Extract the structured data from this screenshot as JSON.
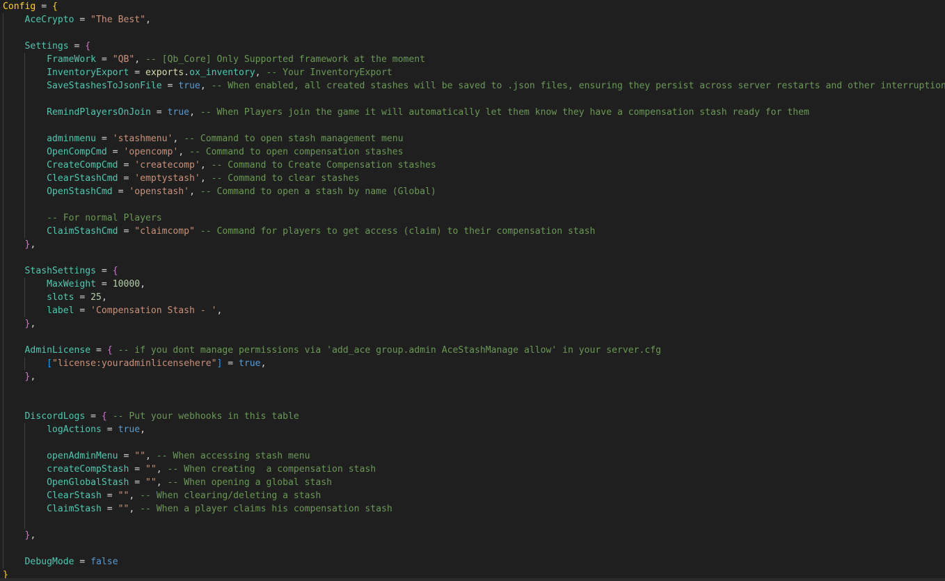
{
  "editor": {
    "lines": [
      [
        {
          "t": "Config",
          "c": "t-cfg"
        },
        {
          "t": " = ",
          "c": "t-op"
        },
        {
          "t": "{",
          "c": "b0"
        }
      ],
      [
        {
          "t": "    "
        },
        {
          "t": "AceCrypto",
          "c": "t-var"
        },
        {
          "t": " = ",
          "c": "t-op"
        },
        {
          "t": "\"The Best\"",
          "c": "t-str"
        },
        {
          "t": ",",
          "c": "t-op"
        }
      ],
      [],
      [
        {
          "t": "    "
        },
        {
          "t": "Settings",
          "c": "t-var"
        },
        {
          "t": " = ",
          "c": "t-op"
        },
        {
          "t": "{",
          "c": "b1"
        }
      ],
      [
        {
          "t": "        "
        },
        {
          "t": "FrameWork",
          "c": "t-var"
        },
        {
          "t": " = ",
          "c": "t-op"
        },
        {
          "t": "\"QB\"",
          "c": "t-str"
        },
        {
          "t": ", ",
          "c": "t-op"
        },
        {
          "t": "-- [Qb_Core] Only Supported framework at the moment",
          "c": "t-com"
        }
      ],
      [
        {
          "t": "        "
        },
        {
          "t": "InventoryExport",
          "c": "t-var"
        },
        {
          "t": " = ",
          "c": "t-op"
        },
        {
          "t": "exports",
          "c": "t-fn"
        },
        {
          "t": ".",
          "c": "t-op"
        },
        {
          "t": "ox_inventory",
          "c": "t-var"
        },
        {
          "t": ", ",
          "c": "t-op"
        },
        {
          "t": "-- Your InventoryExport",
          "c": "t-com"
        }
      ],
      [
        {
          "t": "        "
        },
        {
          "t": "SaveStashesToJsonFile",
          "c": "t-var"
        },
        {
          "t": " = ",
          "c": "t-op"
        },
        {
          "t": "true",
          "c": "t-kw"
        },
        {
          "t": ", ",
          "c": "t-op"
        },
        {
          "t": "-- When enabled, all created stashes will be saved to .json files, ensuring they persist across server restarts and other interruptions.",
          "c": "t-com"
        }
      ],
      [],
      [
        {
          "t": "        "
        },
        {
          "t": "RemindPlayersOnJoin",
          "c": "t-var"
        },
        {
          "t": " = ",
          "c": "t-op"
        },
        {
          "t": "true",
          "c": "t-kw"
        },
        {
          "t": ", ",
          "c": "t-op"
        },
        {
          "t": "-- When Players join the game it will automatically let them know they have a compensation stash ready for them",
          "c": "t-com"
        }
      ],
      [],
      [
        {
          "t": "        "
        },
        {
          "t": "adminmenu",
          "c": "t-var"
        },
        {
          "t": " = ",
          "c": "t-op"
        },
        {
          "t": "'stashmenu'",
          "c": "t-str"
        },
        {
          "t": ", ",
          "c": "t-op"
        },
        {
          "t": "-- Command to open stash management menu",
          "c": "t-com"
        }
      ],
      [
        {
          "t": "        "
        },
        {
          "t": "OpenCompCmd",
          "c": "t-var"
        },
        {
          "t": " = ",
          "c": "t-op"
        },
        {
          "t": "'opencomp'",
          "c": "t-str"
        },
        {
          "t": ", ",
          "c": "t-op"
        },
        {
          "t": "-- Command to open compensation stashes",
          "c": "t-com"
        }
      ],
      [
        {
          "t": "        "
        },
        {
          "t": "CreateCompCmd",
          "c": "t-var"
        },
        {
          "t": " = ",
          "c": "t-op"
        },
        {
          "t": "'createcomp'",
          "c": "t-str"
        },
        {
          "t": ", ",
          "c": "t-op"
        },
        {
          "t": "-- Command to Create Compensation stashes",
          "c": "t-com"
        }
      ],
      [
        {
          "t": "        "
        },
        {
          "t": "ClearStashCmd",
          "c": "t-var"
        },
        {
          "t": " = ",
          "c": "t-op"
        },
        {
          "t": "'emptystash'",
          "c": "t-str"
        },
        {
          "t": ", ",
          "c": "t-op"
        },
        {
          "t": "-- Command to clear stashes",
          "c": "t-com"
        }
      ],
      [
        {
          "t": "        "
        },
        {
          "t": "OpenStashCmd",
          "c": "t-var"
        },
        {
          "t": " = ",
          "c": "t-op"
        },
        {
          "t": "'openstash'",
          "c": "t-str"
        },
        {
          "t": ", ",
          "c": "t-op"
        },
        {
          "t": "-- Command to open a stash by name (Global)",
          "c": "t-com"
        }
      ],
      [],
      [
        {
          "t": "        "
        },
        {
          "t": "-- For normal Players",
          "c": "t-com"
        }
      ],
      [
        {
          "t": "        "
        },
        {
          "t": "ClaimStashCmd",
          "c": "t-var"
        },
        {
          "t": " = ",
          "c": "t-op"
        },
        {
          "t": "\"claimcomp\"",
          "c": "t-str"
        },
        {
          "t": " ",
          "c": "t-op"
        },
        {
          "t": "-- Command for players to get access (claim) to their compensation stash",
          "c": "t-com"
        }
      ],
      [
        {
          "t": "    "
        },
        {
          "t": "}",
          "c": "b1"
        },
        {
          "t": ",",
          "c": "t-op"
        }
      ],
      [],
      [
        {
          "t": "    "
        },
        {
          "t": "StashSettings",
          "c": "t-var"
        },
        {
          "t": " = ",
          "c": "t-op"
        },
        {
          "t": "{",
          "c": "b1"
        }
      ],
      [
        {
          "t": "        "
        },
        {
          "t": "MaxWeight",
          "c": "t-var"
        },
        {
          "t": " = ",
          "c": "t-op"
        },
        {
          "t": "10000",
          "c": "t-num"
        },
        {
          "t": ",",
          "c": "t-op"
        }
      ],
      [
        {
          "t": "        "
        },
        {
          "t": "slots",
          "c": "t-var"
        },
        {
          "t": " = ",
          "c": "t-op"
        },
        {
          "t": "25",
          "c": "t-num"
        },
        {
          "t": ",",
          "c": "t-op"
        }
      ],
      [
        {
          "t": "        "
        },
        {
          "t": "label",
          "c": "t-var"
        },
        {
          "t": " = ",
          "c": "t-op"
        },
        {
          "t": "'Compensation Stash - '",
          "c": "t-str"
        },
        {
          "t": ",",
          "c": "t-op"
        }
      ],
      [
        {
          "t": "    "
        },
        {
          "t": "}",
          "c": "b1"
        },
        {
          "t": ",",
          "c": "t-op"
        }
      ],
      [],
      [
        {
          "t": "    "
        },
        {
          "t": "AdminLicense",
          "c": "t-var"
        },
        {
          "t": " = ",
          "c": "t-op"
        },
        {
          "t": "{",
          "c": "b1"
        },
        {
          "t": " ",
          "c": "t-op"
        },
        {
          "t": "-- if you dont manage permissions via 'add_ace group.admin AceStashManage allow' in your server.cfg",
          "c": "t-com"
        }
      ],
      [
        {
          "t": "        "
        },
        {
          "t": "[",
          "c": "b2"
        },
        {
          "t": "\"license:youradminlicensehere\"",
          "c": "t-str"
        },
        {
          "t": "]",
          "c": "b2"
        },
        {
          "t": " = ",
          "c": "t-op"
        },
        {
          "t": "true",
          "c": "t-kw"
        },
        {
          "t": ",",
          "c": "t-op"
        }
      ],
      [
        {
          "t": "    "
        },
        {
          "t": "}",
          "c": "b1"
        },
        {
          "t": ",",
          "c": "t-op"
        }
      ],
      [],
      [],
      [
        {
          "t": "    "
        },
        {
          "t": "DiscordLogs",
          "c": "t-var"
        },
        {
          "t": " = ",
          "c": "t-op"
        },
        {
          "t": "{",
          "c": "b1"
        },
        {
          "t": " ",
          "c": "t-op"
        },
        {
          "t": "-- Put your webhooks in this table",
          "c": "t-com"
        }
      ],
      [
        {
          "t": "        "
        },
        {
          "t": "logActions",
          "c": "t-var"
        },
        {
          "t": " = ",
          "c": "t-op"
        },
        {
          "t": "true",
          "c": "t-kw"
        },
        {
          "t": ",",
          "c": "t-op"
        }
      ],
      [],
      [
        {
          "t": "        "
        },
        {
          "t": "openAdminMenu",
          "c": "t-var"
        },
        {
          "t": " = ",
          "c": "t-op"
        },
        {
          "t": "\"\"",
          "c": "t-str"
        },
        {
          "t": ", ",
          "c": "t-op"
        },
        {
          "t": "-- When accessing stash menu",
          "c": "t-com"
        }
      ],
      [
        {
          "t": "        "
        },
        {
          "t": "createCompStash",
          "c": "t-var"
        },
        {
          "t": " = ",
          "c": "t-op"
        },
        {
          "t": "\"\"",
          "c": "t-str"
        },
        {
          "t": ", ",
          "c": "t-op"
        },
        {
          "t": "-- When creating  a compensation stash",
          "c": "t-com"
        }
      ],
      [
        {
          "t": "        "
        },
        {
          "t": "OpenGlobalStash",
          "c": "t-var"
        },
        {
          "t": " = ",
          "c": "t-op"
        },
        {
          "t": "\"\"",
          "c": "t-str"
        },
        {
          "t": ", ",
          "c": "t-op"
        },
        {
          "t": "-- When opening a global stash",
          "c": "t-com"
        }
      ],
      [
        {
          "t": "        "
        },
        {
          "t": "ClearStash",
          "c": "t-var"
        },
        {
          "t": " = ",
          "c": "t-op"
        },
        {
          "t": "\"\"",
          "c": "t-str"
        },
        {
          "t": ", ",
          "c": "t-op"
        },
        {
          "t": "-- When clearing/deleting a stash",
          "c": "t-com"
        }
      ],
      [
        {
          "t": "        "
        },
        {
          "t": "ClaimStash",
          "c": "t-var"
        },
        {
          "t": " = ",
          "c": "t-op"
        },
        {
          "t": "\"\"",
          "c": "t-str"
        },
        {
          "t": ", ",
          "c": "t-op"
        },
        {
          "t": "-- When a player claims his compensation stash",
          "c": "t-com"
        }
      ],
      [],
      [
        {
          "t": "    "
        },
        {
          "t": "}",
          "c": "b1"
        },
        {
          "t": ",",
          "c": "t-op"
        }
      ],
      [],
      [
        {
          "t": "    "
        },
        {
          "t": "DebugMode",
          "c": "t-var"
        },
        {
          "t": " = ",
          "c": "t-op"
        },
        {
          "t": "false",
          "c": "t-kw"
        }
      ],
      [
        {
          "t": "}",
          "c": "b0"
        }
      ]
    ],
    "guides": [
      [],
      [
        1
      ],
      [
        1
      ],
      [
        1
      ],
      [
        1,
        2
      ],
      [
        1,
        2
      ],
      [
        1,
        2
      ],
      [
        1,
        2
      ],
      [
        1,
        2
      ],
      [
        1,
        2
      ],
      [
        1,
        2
      ],
      [
        1,
        2
      ],
      [
        1,
        2
      ],
      [
        1,
        2
      ],
      [
        1,
        2
      ],
      [
        1,
        2
      ],
      [
        1,
        2
      ],
      [
        1,
        2
      ],
      [
        1
      ],
      [
        1
      ],
      [
        1
      ],
      [
        1,
        2
      ],
      [
        1,
        2
      ],
      [
        1,
        2
      ],
      [
        1
      ],
      [
        1
      ],
      [
        1
      ],
      [
        1,
        2
      ],
      [
        1
      ],
      [
        1
      ],
      [
        1
      ],
      [
        1
      ],
      [
        1,
        2
      ],
      [
        1,
        2
      ],
      [
        1,
        2
      ],
      [
        1,
        2
      ],
      [
        1,
        2
      ],
      [
        1,
        2
      ],
      [
        1,
        2
      ],
      [
        1,
        2
      ],
      [
        1
      ],
      [
        1
      ],
      [
        1
      ],
      []
    ]
  }
}
